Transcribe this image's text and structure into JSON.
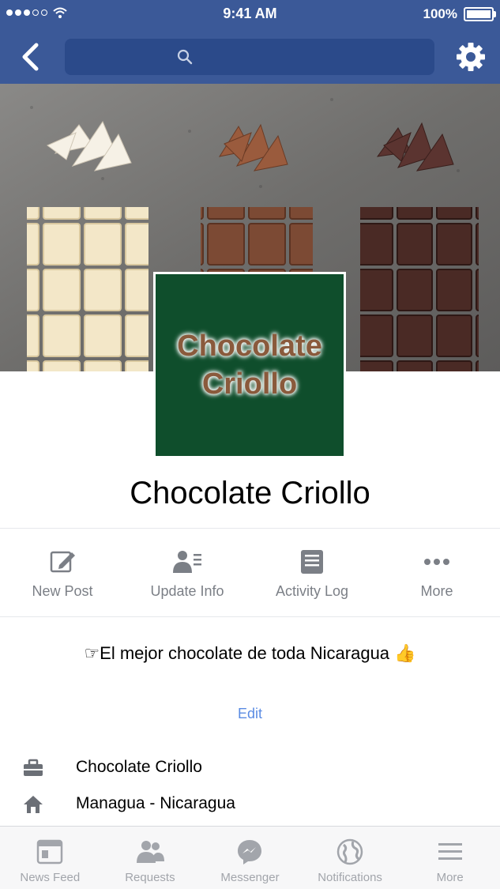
{
  "status_bar": {
    "time": "9:41 AM",
    "battery": "100%"
  },
  "header": {
    "back_icon": "chevron-left-icon",
    "search_icon": "search-icon",
    "settings_icon": "gear-icon"
  },
  "page": {
    "profile_logo_line1": "Chocolate",
    "profile_logo_line2": "Criollo",
    "name": "Chocolate Criollo"
  },
  "actions": [
    {
      "label": "New Post",
      "icon": "edit-icon"
    },
    {
      "label": "Update Info",
      "icon": "update-info-icon"
    },
    {
      "label": "Activity Log",
      "icon": "activity-log-icon"
    },
    {
      "label": "More",
      "icon": "more-icon"
    }
  ],
  "about": {
    "tagline": "☞El mejor chocolate de toda Nicaragua 👍",
    "edit_label": "Edit",
    "items": [
      {
        "icon": "briefcase-icon",
        "text": "Chocolate Criollo"
      },
      {
        "icon": "home-icon",
        "text": "Managua - Nicaragua"
      }
    ]
  },
  "tabbar": [
    {
      "label": "News Feed",
      "icon": "news-feed-icon"
    },
    {
      "label": "Requests",
      "icon": "requests-icon"
    },
    {
      "label": "Messenger",
      "icon": "messenger-icon"
    },
    {
      "label": "Notifications",
      "icon": "globe-icon"
    },
    {
      "label": "More",
      "icon": "menu-icon"
    }
  ],
  "colors": {
    "header": "#3b5998",
    "profile_bg": "#0f4e2c",
    "logo_text": "#8a5a3c",
    "link": "#5b8ce3"
  }
}
